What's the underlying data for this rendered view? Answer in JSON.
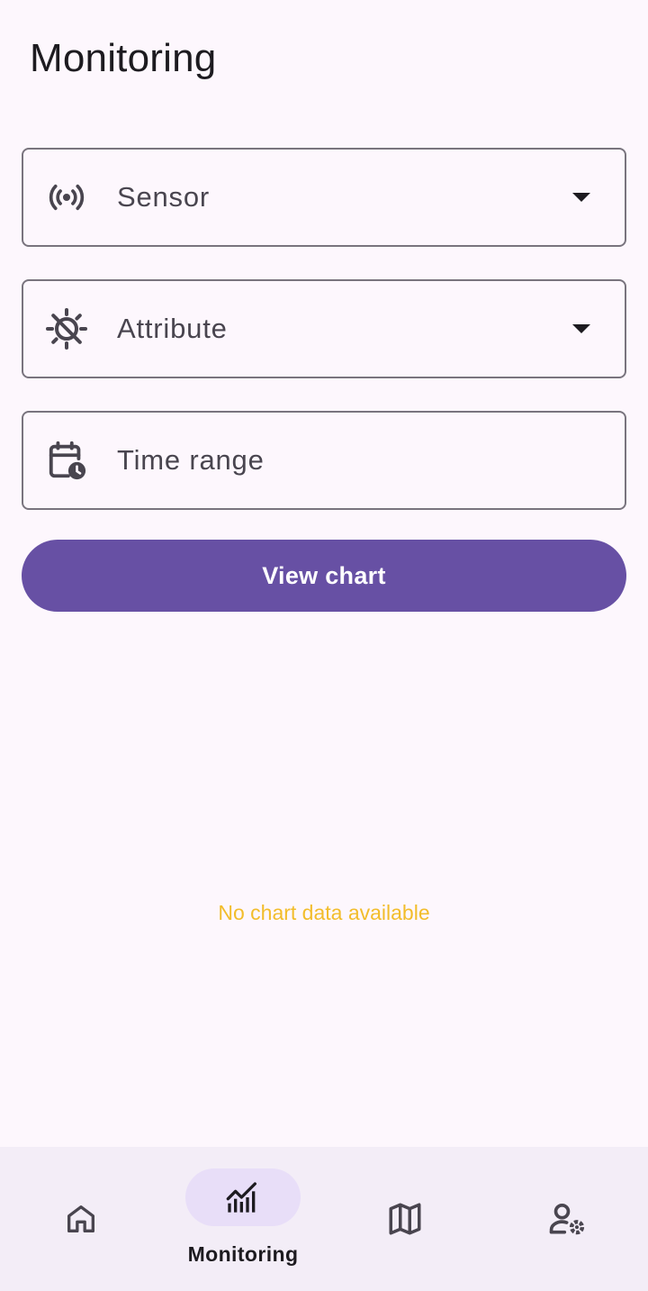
{
  "header": {
    "title": "Monitoring"
  },
  "form": {
    "sensor": {
      "label": "Sensor",
      "icon": "sensors-icon"
    },
    "attribute": {
      "label": "Attribute",
      "icon": "wb-twilight-icon"
    },
    "time_range": {
      "label": "Time range",
      "icon": "calendar-clock-icon"
    },
    "view_chart_label": "View chart"
  },
  "chart_area": {
    "empty_message": "No chart data available"
  },
  "bottom_nav": {
    "items": [
      {
        "id": "home",
        "label": "",
        "icon": "home-icon",
        "active": false
      },
      {
        "id": "monitoring",
        "label": "Monitoring",
        "icon": "monitoring-icon",
        "active": true
      },
      {
        "id": "map",
        "label": "",
        "icon": "map-icon",
        "active": false
      },
      {
        "id": "account",
        "label": "",
        "icon": "manage-accounts-icon",
        "active": false
      }
    ]
  },
  "colors": {
    "background": "#fdf7fd",
    "primary": "#6750a4",
    "outline": "#79747e",
    "nav_background": "#f3edf7",
    "nav_indicator": "#e8def8",
    "warning_text": "#f2bd2b"
  }
}
